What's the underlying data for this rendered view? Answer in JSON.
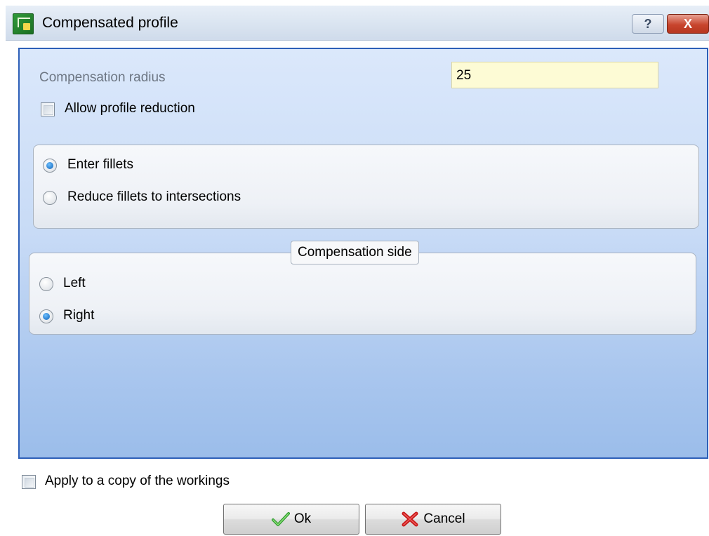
{
  "window": {
    "title": "Compensated profile",
    "help_label": "?",
    "close_label": "X"
  },
  "form": {
    "radius_label": "Compensation radius",
    "radius_value": "25",
    "allow_reduction_label": "Allow profile reduction",
    "allow_reduction_checked": false
  },
  "fillets": {
    "options": [
      {
        "label": "Enter fillets",
        "checked": true
      },
      {
        "label": "Reduce fillets to intersections",
        "checked": false
      }
    ]
  },
  "side": {
    "legend": "Compensation side",
    "options": [
      {
        "label": "Left",
        "checked": false
      },
      {
        "label": "Right",
        "checked": true
      }
    ]
  },
  "footer": {
    "apply_copy_label": "Apply to a copy of the workings",
    "apply_copy_checked": false,
    "ok_label": "Ok",
    "cancel_label": "Cancel"
  },
  "icons": {
    "app": "app-icon",
    "help": "help-icon",
    "close": "close-icon",
    "ok": "checkmark-icon",
    "cancel": "red-x-icon"
  },
  "colors": {
    "panel_top": "#dbe8fb",
    "panel_bottom": "#9bbdea",
    "panel_border": "#2d5fb8",
    "input_bg": "#fdfbd5",
    "radio_selected": "#0a5fb6"
  }
}
